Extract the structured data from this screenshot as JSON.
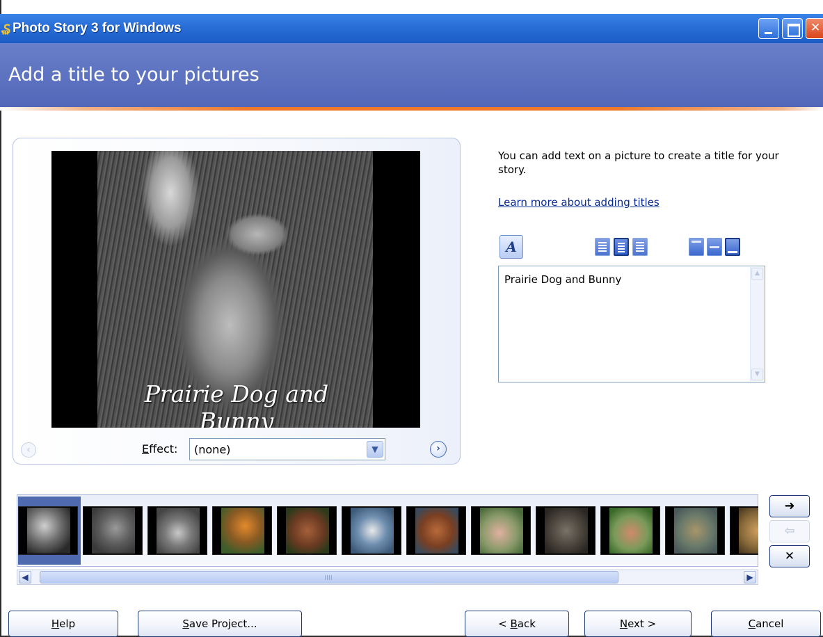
{
  "window": {
    "title": "Photo Story 3 for Windows",
    "icon": "app-icon",
    "controls": [
      "minimize-icon",
      "maximize-icon",
      "close-icon"
    ]
  },
  "header": {
    "title": "Add a title to your pictures"
  },
  "preview": {
    "caption": "Prairie Dog and Bunny",
    "effect_label": "ffect:",
    "effect_label_accel": "E",
    "effect_value": "(none)"
  },
  "instructions": {
    "text": "You can add text on a picture to create a title for your story.",
    "link": "Learn more about adding titles"
  },
  "title_editor": {
    "value": "Prairie Dog and Bunny"
  },
  "filmstrip": {
    "thumbnail_count": 13,
    "selected_index": 0,
    "scroll_grip": "IIII"
  },
  "side_buttons": {
    "move_right": "➜",
    "move_left": "⇦",
    "remove": "✕"
  },
  "footer": {
    "help": "elp",
    "help_accel": "H",
    "save": "ave Project...",
    "save_accel": "S",
    "back_prefix": "< ",
    "back_accel": "B",
    "back": "ack",
    "next_accel": "N",
    "next": "ext >",
    "cancel_accel": "C",
    "cancel": "ancel"
  },
  "colors": {
    "titlebar": "#2a6fd8",
    "header": "#5a6fbd",
    "accent_line": "#ee7a2a",
    "selection": "#4f6aae"
  }
}
